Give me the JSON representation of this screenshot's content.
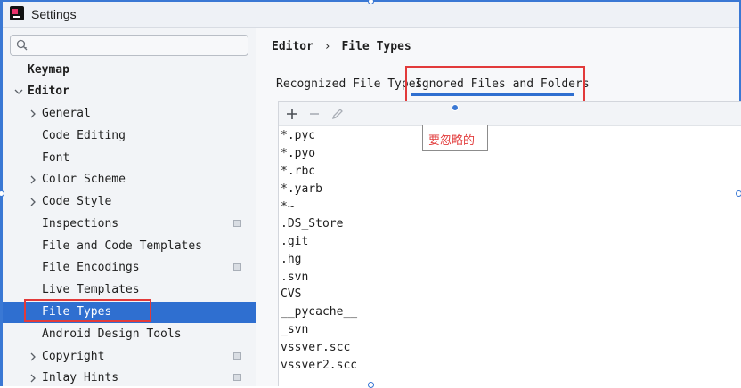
{
  "window": {
    "title": "Settings"
  },
  "search": {
    "placeholder": ""
  },
  "sidebar": {
    "items": [
      {
        "label": "Keymap"
      },
      {
        "label": "Editor"
      },
      {
        "label": "General"
      },
      {
        "label": "Code Editing"
      },
      {
        "label": "Font"
      },
      {
        "label": "Color Scheme"
      },
      {
        "label": "Code Style"
      },
      {
        "label": "Inspections"
      },
      {
        "label": "File and Code Templates"
      },
      {
        "label": "File Encodings"
      },
      {
        "label": "Live Templates"
      },
      {
        "label": "File Types"
      },
      {
        "label": "Android Design Tools"
      },
      {
        "label": "Copyright"
      },
      {
        "label": "Inlay Hints"
      }
    ]
  },
  "breadcrumb": {
    "parent": "Editor",
    "separator": "›",
    "current": "File Types"
  },
  "tabs": [
    {
      "label": "Recognized File Types",
      "active": false
    },
    {
      "label": "Ignored Files and Folders",
      "active": true
    }
  ],
  "toolbar": {
    "add_icon": "plus-icon",
    "remove_icon": "minus-icon",
    "edit_icon": "pencil-icon"
  },
  "ignored_list": [
    "*.pyc",
    "*.pyo",
    "*.rbc",
    "*.yarb",
    "*~",
    ".DS_Store",
    ".git",
    ".hg",
    ".svn",
    "CVS",
    "__pycache__",
    "_svn",
    "vssver.scc",
    "vssver2.scc"
  ],
  "annotation": {
    "text": "要忽略的"
  },
  "colors": {
    "accent": "#2f6fd0",
    "highlight_box": "#e23a3a",
    "selection_text": "#ffffff"
  }
}
